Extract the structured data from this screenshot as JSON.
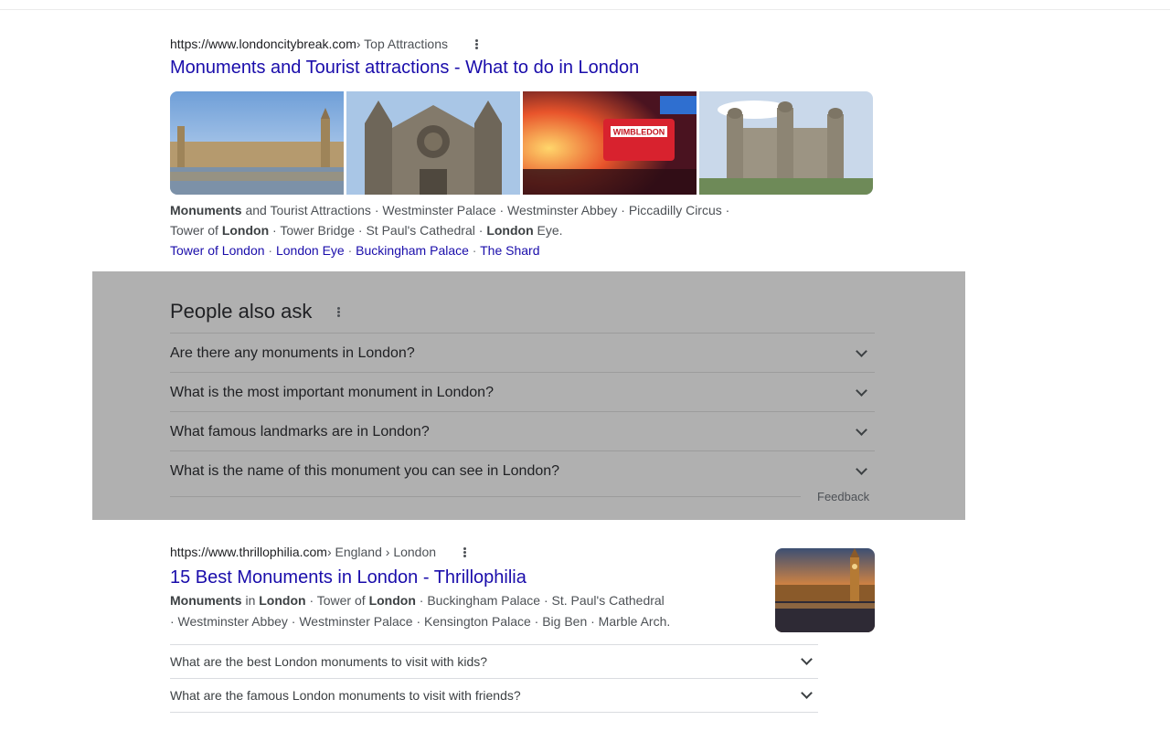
{
  "result1": {
    "url": "https://www.londoncitybreak.com",
    "crumbs": " › Top Attractions",
    "title": "Monuments and Tourist attractions - What to do in London",
    "images": [
      {
        "label": "Westminster Palace",
        "icon": "parliament-image"
      },
      {
        "label": "Westminster Abbey",
        "icon": "abbey-image"
      },
      {
        "label": "WIMBLEDON",
        "icon": "piccadilly-image"
      },
      {
        "label": "Tower of London",
        "icon": "tower-image"
      }
    ],
    "snippet": {
      "line1_b1": "Monuments",
      "line1_t1": " and Tourist Attractions · Westminster Palace · Westminster Abbey · Piccadilly Circus ·",
      "line2_t1": "Tower of ",
      "line2_b1": "London",
      "line2_t2": " · Tower Bridge · St Paul's Cathedral · ",
      "line2_b2": "London",
      "line2_t3": " Eye."
    },
    "sitelinks": [
      "Tower of London",
      "London Eye",
      "Buckingham Palace",
      "The Shard"
    ],
    "sep": " · "
  },
  "paa": {
    "title": "People also ask",
    "questions": [
      "Are there any monuments in London?",
      "What is the most important monument in London?",
      "What famous landmarks are in London?",
      "What is the name of this monument you can see in London?"
    ],
    "feedback": "Feedback"
  },
  "result2": {
    "url": "https://www.thrillophilia.com",
    "crumbs": " › England › London",
    "title": "15 Best Monuments in London - Thrillophilia",
    "snippet": {
      "l1_b1": "Monuments",
      "l1_t1": " in ",
      "l1_b2": "London",
      "l1_t2": " · Tower of ",
      "l1_b3": "London",
      "l1_t3": " · Buckingham Palace · St. Paul's Cathedral",
      "l2": "· Westminster Abbey · Westminster Palace · Kensington Palace · Big Ben · Marble Arch."
    },
    "subquestions": [
      "What are the best London monuments to visit with kids?",
      "What are the famous London monuments to visit with friends?"
    ]
  },
  "colors": {
    "link": "#1a0dab",
    "overlay": "#b0b0b0"
  }
}
